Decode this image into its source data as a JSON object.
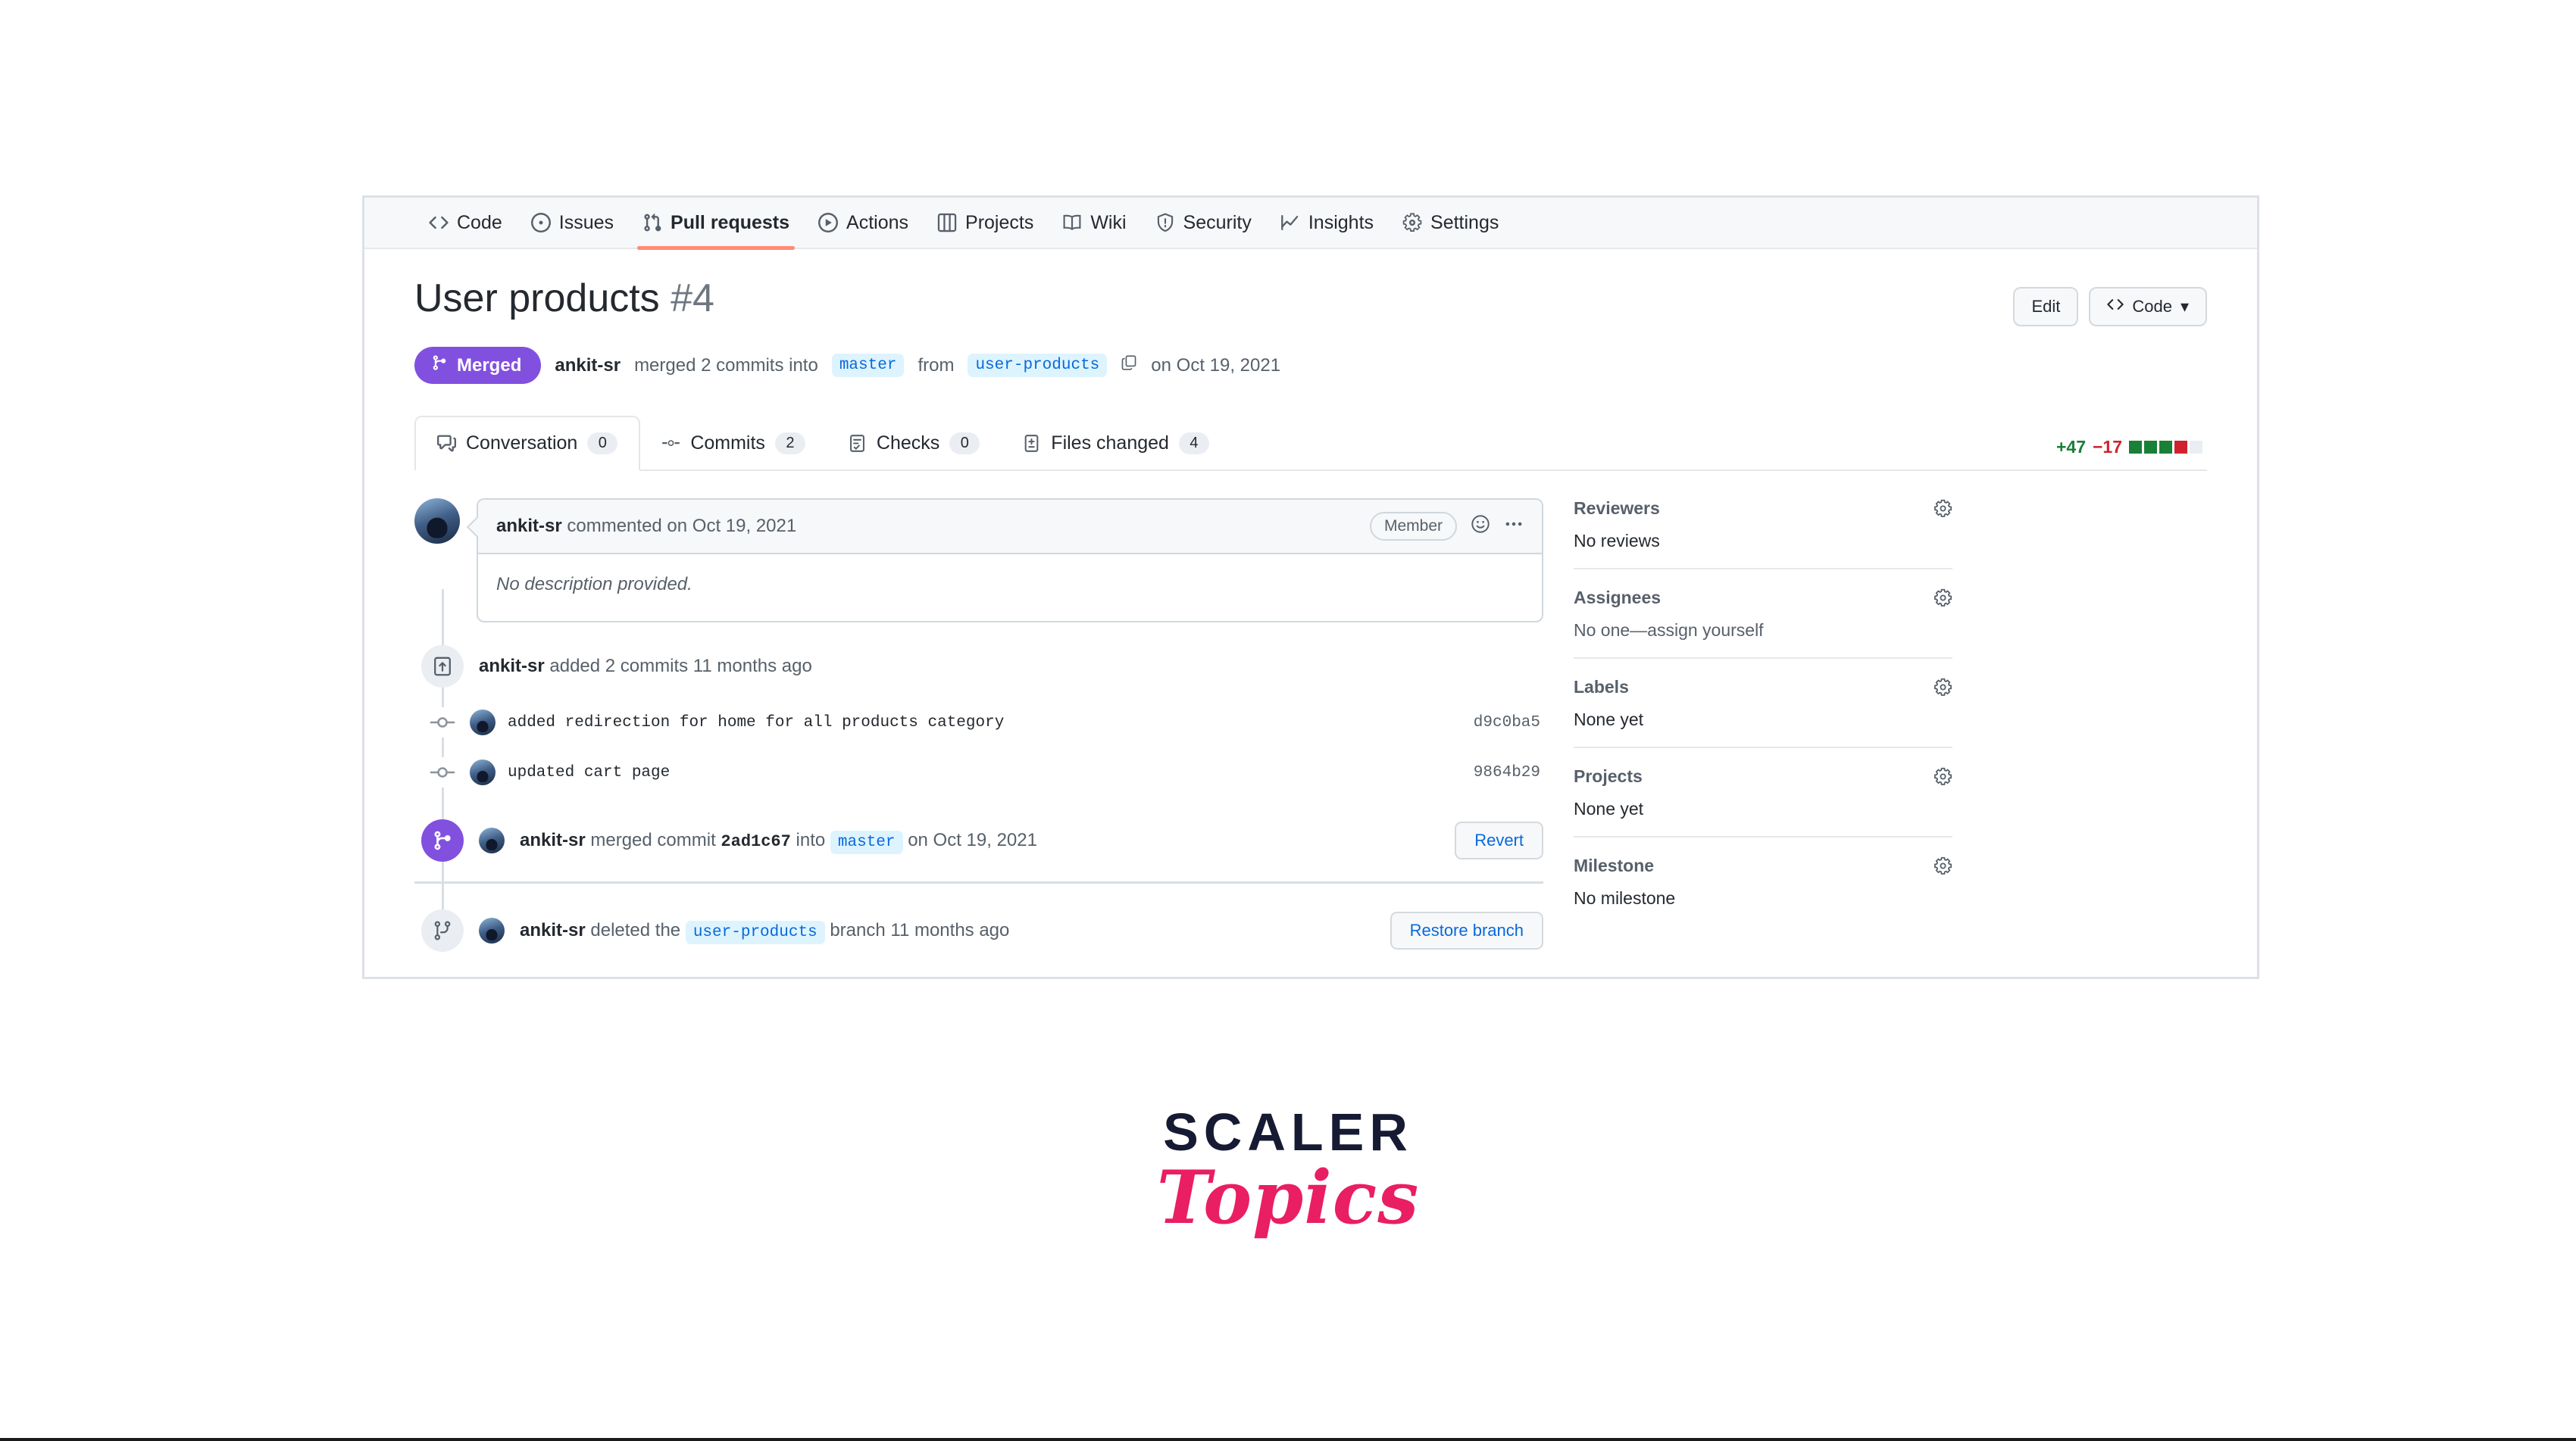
{
  "repo_nav": {
    "items": [
      {
        "label": "Code",
        "icon": "code-icon",
        "active": false
      },
      {
        "label": "Issues",
        "icon": "issue-opened-icon",
        "active": false
      },
      {
        "label": "Pull requests",
        "icon": "git-pull-request-icon",
        "active": true
      },
      {
        "label": "Actions",
        "icon": "play-icon",
        "active": false
      },
      {
        "label": "Projects",
        "icon": "project-icon",
        "active": false
      },
      {
        "label": "Wiki",
        "icon": "book-icon",
        "active": false
      },
      {
        "label": "Security",
        "icon": "shield-icon",
        "active": false
      },
      {
        "label": "Insights",
        "icon": "graph-icon",
        "active": false
      },
      {
        "label": "Settings",
        "icon": "gear-icon",
        "active": false
      }
    ]
  },
  "header": {
    "title": "User products",
    "number": "#4",
    "edit_label": "Edit",
    "code_label": "Code",
    "status_badge": "Merged",
    "merge_author": "ankit-sr",
    "merge_text_1": "merged 2 commits into",
    "base_branch": "master",
    "merge_text_2": "from",
    "head_branch": "user-products",
    "merge_date": "on Oct 19, 2021"
  },
  "tabs": [
    {
      "label": "Conversation",
      "count": "0",
      "icon": "comment-discussion-icon",
      "active": true
    },
    {
      "label": "Commits",
      "count": "2",
      "icon": "git-commit-icon",
      "active": false
    },
    {
      "label": "Checks",
      "count": "0",
      "icon": "checklist-icon",
      "active": false
    },
    {
      "label": "Files changed",
      "count": "4",
      "icon": "file-diff-icon",
      "active": false
    }
  ],
  "diffstat": {
    "additions": "+47",
    "deletions": "−17",
    "blocks": [
      "g",
      "g",
      "g",
      "r",
      "n"
    ],
    "add_color": "#1a7f37",
    "del_color": "#cf222e"
  },
  "comment": {
    "author": "ankit-sr",
    "action": "commented on Oct 19, 2021",
    "member_badge": "Member",
    "body": "No description provided."
  },
  "timeline": {
    "commits_header": {
      "author": "ankit-sr",
      "text": "added 2 commits 11 months ago"
    },
    "commits": [
      {
        "message": "added redirection for home for all products category",
        "sha": "d9c0ba5"
      },
      {
        "message": "updated cart page",
        "sha": "9864b29"
      }
    ],
    "merged_event": {
      "author": "ankit-sr",
      "text_1": "merged commit",
      "commit_sha": "2ad1c67",
      "text_2": "into",
      "branch": "master",
      "date": "on Oct 19, 2021",
      "button": "Revert"
    },
    "deleted_event": {
      "author": "ankit-sr",
      "text_1": "deleted the",
      "branch": "user-products",
      "text_2": "branch 11 months ago",
      "button": "Restore branch"
    }
  },
  "sidebar": {
    "sections": [
      {
        "title": "Reviewers",
        "value": "No reviews"
      },
      {
        "title": "Assignees",
        "value": "No one—assign yourself"
      },
      {
        "title": "Labels",
        "value": "None yet"
      },
      {
        "title": "Projects",
        "value": "None yet"
      },
      {
        "title": "Milestone",
        "value": "No milestone"
      }
    ]
  },
  "logo": {
    "primary": "SCALER",
    "secondary": "Topics",
    "primary_color": "#161a33",
    "secondary_color": "#e91e63"
  }
}
